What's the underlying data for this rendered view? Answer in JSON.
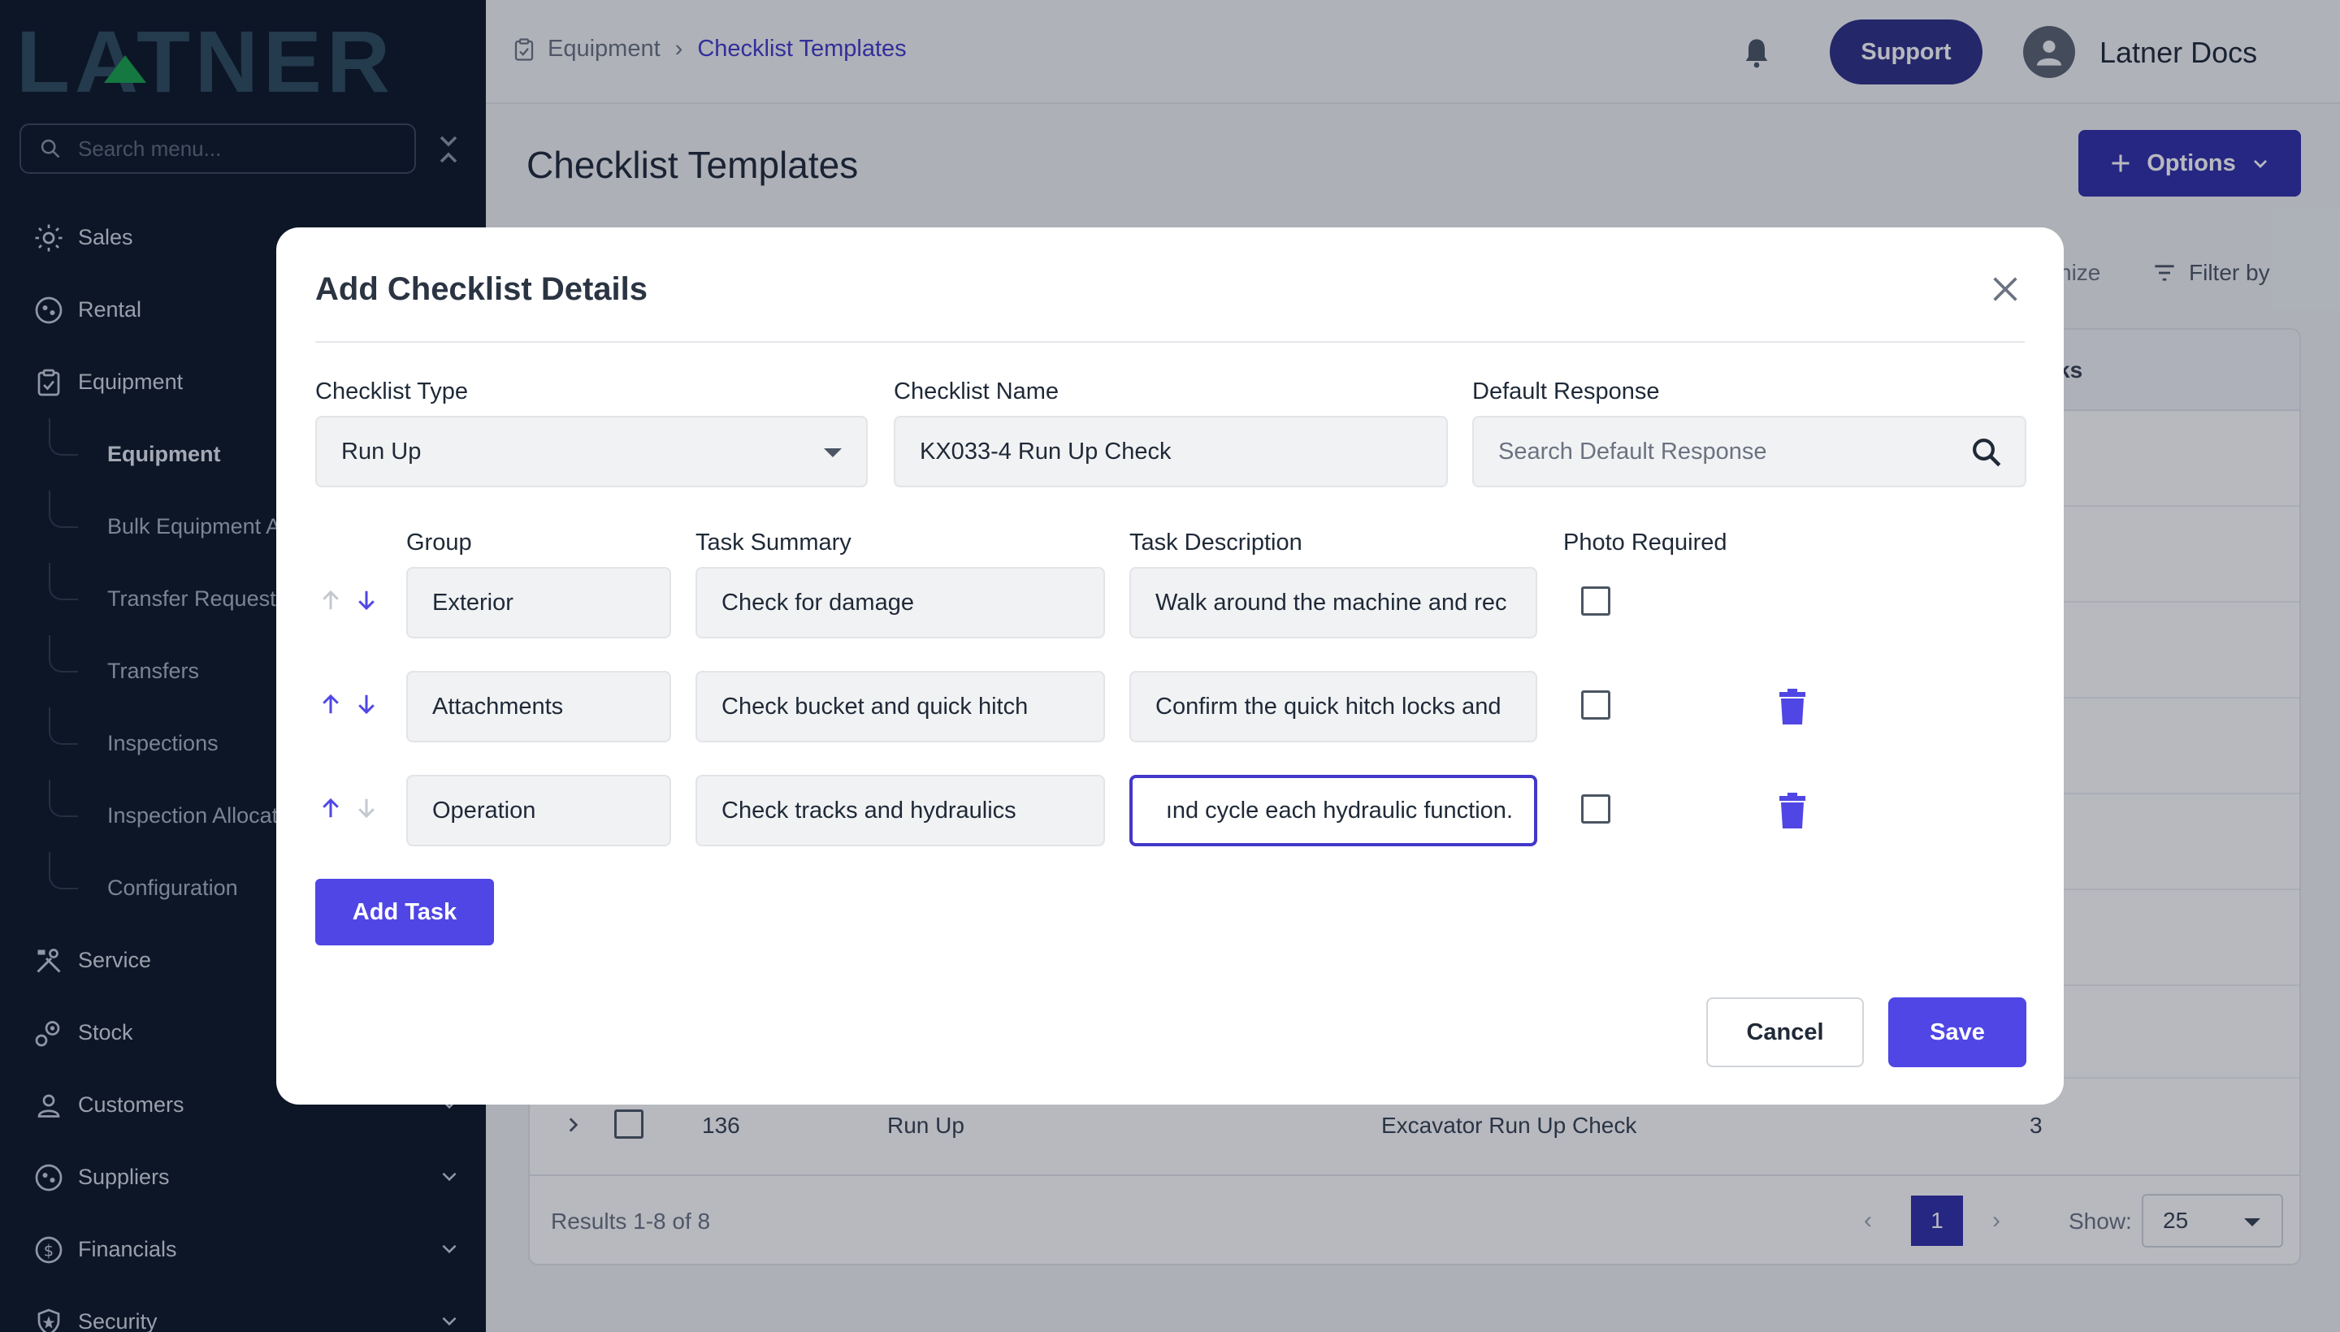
{
  "sidebar": {
    "logo": "LATNER",
    "search_placeholder": "Search menu...",
    "items": [
      {
        "label": "Sales"
      },
      {
        "label": "Rental"
      },
      {
        "label": "Equipment"
      },
      {
        "label": "Service"
      },
      {
        "label": "Stock"
      },
      {
        "label": "Customers"
      },
      {
        "label": "Suppliers"
      },
      {
        "label": "Financials"
      },
      {
        "label": "Security"
      }
    ],
    "equipment_sub": [
      {
        "label": "Equipment"
      },
      {
        "label": "Bulk Equipment A"
      },
      {
        "label": "Transfer Requests"
      },
      {
        "label": "Transfers"
      },
      {
        "label": "Inspections"
      },
      {
        "label": "Inspection Allocat"
      },
      {
        "label": "Configuration"
      }
    ]
  },
  "header": {
    "breadcrumb": [
      "Equipment",
      "Checklist Templates"
    ],
    "support_label": "Support",
    "user_name": "Latner Docs"
  },
  "page": {
    "title": "Checklist Templates",
    "options_label": "Options",
    "customize_fragment": "nize",
    "filter_label": "Filter by",
    "tasks_header_fragment": "ks",
    "last_row": {
      "id": "136",
      "type": "Run Up",
      "name": "Excavator Run Up Check",
      "tasks": "3"
    },
    "results": "Results 1-8 of 8",
    "current_page": "1",
    "show_label": "Show:",
    "show_value": "25"
  },
  "modal": {
    "title": "Add Checklist Details",
    "checklist_type_label": "Checklist Type",
    "checklist_type_value": "Run Up",
    "checklist_name_label": "Checklist Name",
    "checklist_name_value": "KX033-4 Run Up Check",
    "default_response_label": "Default Response",
    "default_response_placeholder": "Search Default Response",
    "col_group": "Group",
    "col_summary": "Task Summary",
    "col_description": "Task Description",
    "col_photo": "Photo Required",
    "tasks": [
      {
        "group": "Exterior",
        "summary": "Check for damage",
        "description": "Walk around the machine and rec",
        "photo_required": false
      },
      {
        "group": "Attachments",
        "summary": "Check bucket and quick hitch",
        "description": "Confirm the quick hitch locks and",
        "photo_required": false
      },
      {
        "group": "Operation",
        "summary": "Check tracks and hydraulics",
        "description": "ınd cycle each hydraulic function.",
        "photo_required": false
      }
    ],
    "add_task_label": "Add Task",
    "cancel_label": "Cancel",
    "save_label": "Save"
  },
  "colors": {
    "sidebar_bg": "#0b1626",
    "accent": "#4f46e5",
    "accent_dark": "#302ea8",
    "logo": "#2d4a5c",
    "logo_triangle": "#16a34a"
  }
}
